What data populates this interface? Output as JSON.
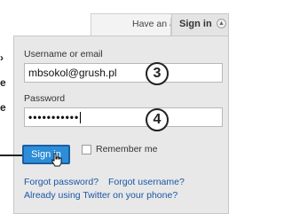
{
  "header": {
    "have_account": "Have an account?",
    "signin_tab": "Sign in"
  },
  "icons": {
    "collapse": "up-triangle-icon",
    "cursor": "hand-pointer-icon"
  },
  "edge_text": [
    "›",
    "e",
    "e"
  ],
  "form": {
    "username_label": "Username or email",
    "username_value": "mbsokol@grush.pl",
    "password_label": "Password",
    "password_value": "•••••••••••",
    "signin_button": "Sign in",
    "remember_label": "Remember me",
    "forgot_password": "Forgot password?",
    "forgot_username": "Forgot username?",
    "twitter_phone": "Already using Twitter on your phone?"
  },
  "callouts": {
    "username": "3",
    "password": "4"
  },
  "colors": {
    "button_blue": "#2e8dd8",
    "link_blue": "#1a57a6"
  }
}
